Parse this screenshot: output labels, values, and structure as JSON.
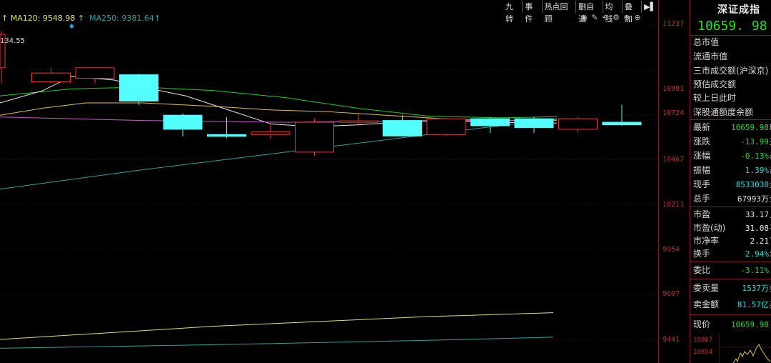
{
  "ma": {
    "ma120": "MA120: 9548.98",
    "ma120_arrow": "↑",
    "ma250": "MA250: 9381.64",
    "ma250_arrow": "↑",
    "colors": {
      "ma120": "#e0e070",
      "ma250": "#30a0a0"
    }
  },
  "toolbar": [
    "九转",
    "事件",
    "热点回顾",
    "删自选",
    "均线",
    "叠加"
  ],
  "price_marker": "134.55",
  "y_axis": [
    "11237",
    "10981",
    "10724",
    "10467",
    "10211",
    "9954",
    "9697",
    "9441"
  ],
  "panel": {
    "title": "深证成指",
    "price": "10659. 98",
    "info_rows": [
      "总市值",
      "流通市值",
      "三市成交额(沪深京)",
      "预估成交额",
      "较上日此时",
      "深股通额度余额"
    ],
    "quote": [
      {
        "label": "最新",
        "value": "10659.98",
        "suffix": "昨"
      },
      {
        "label": "涨跌",
        "value": "-13.99",
        "suffix": "开"
      },
      {
        "label": "涨幅",
        "value": "-0.13%",
        "suffix": "最"
      },
      {
        "label": "振幅",
        "value": "1.39%",
        "suffix": "最"
      },
      {
        "label": "现手",
        "value": "8533030",
        "suffix": "量"
      },
      {
        "label": "总手",
        "value": "67993万",
        "suffix": "金"
      }
    ],
    "valuation": [
      {
        "label": "市盈",
        "value": "33.17",
        "suffix": "上"
      },
      {
        "label": "市盈(动)",
        "value": "31.08",
        "suffix": "平"
      },
      {
        "label": "市净率",
        "value": "2.21",
        "suffix": "下"
      },
      {
        "label": "换手",
        "value": "2.94%",
        "suffix": "均"
      }
    ],
    "weibi": {
      "label": "委比",
      "value": "-3.11%"
    },
    "orders": [
      {
        "label": "委卖量",
        "value": "1537万",
        "suffix": "委"
      },
      {
        "label": "卖金额",
        "value": "81.57亿",
        "suffix": "买"
      }
    ],
    "current": {
      "label": "现价",
      "value": "10659.98"
    },
    "mini_axis": [
      "10887",
      "10854"
    ]
  },
  "candles": [
    {
      "o": 10990,
      "h": 11200,
      "l": 10900,
      "c": 11180
    },
    {
      "o": 10910,
      "h": 10990,
      "l": 10900,
      "c": 10960
    },
    {
      "o": 10930,
      "h": 10990,
      "l": 10900,
      "c": 10990
    },
    {
      "o": 10950,
      "h": 10955,
      "l": 10780,
      "c": 10800
    },
    {
      "o": 10720,
      "h": 10730,
      "l": 10600,
      "c": 10640
    },
    {
      "o": 10610,
      "h": 10710,
      "l": 10590,
      "c": 10600
    },
    {
      "o": 10610,
      "h": 10680,
      "l": 10585,
      "c": 10625
    },
    {
      "o": 10510,
      "h": 10700,
      "l": 10490,
      "c": 10680
    },
    {
      "o": 10680,
      "h": 10730,
      "l": 10660,
      "c": 10688
    },
    {
      "o": 10690,
      "h": 10720,
      "l": 10600,
      "c": 10602
    },
    {
      "o": 10610,
      "h": 10700,
      "l": 10600,
      "c": 10700
    },
    {
      "o": 10700,
      "h": 10710,
      "l": 10620,
      "c": 10660
    },
    {
      "o": 10700,
      "h": 10710,
      "l": 10620,
      "c": 10650
    },
    {
      "o": 10640,
      "h": 10710,
      "l": 10620,
      "c": 10700
    },
    {
      "o": 10680,
      "h": 10780,
      "l": 10660,
      "c": 10666
    }
  ]
}
